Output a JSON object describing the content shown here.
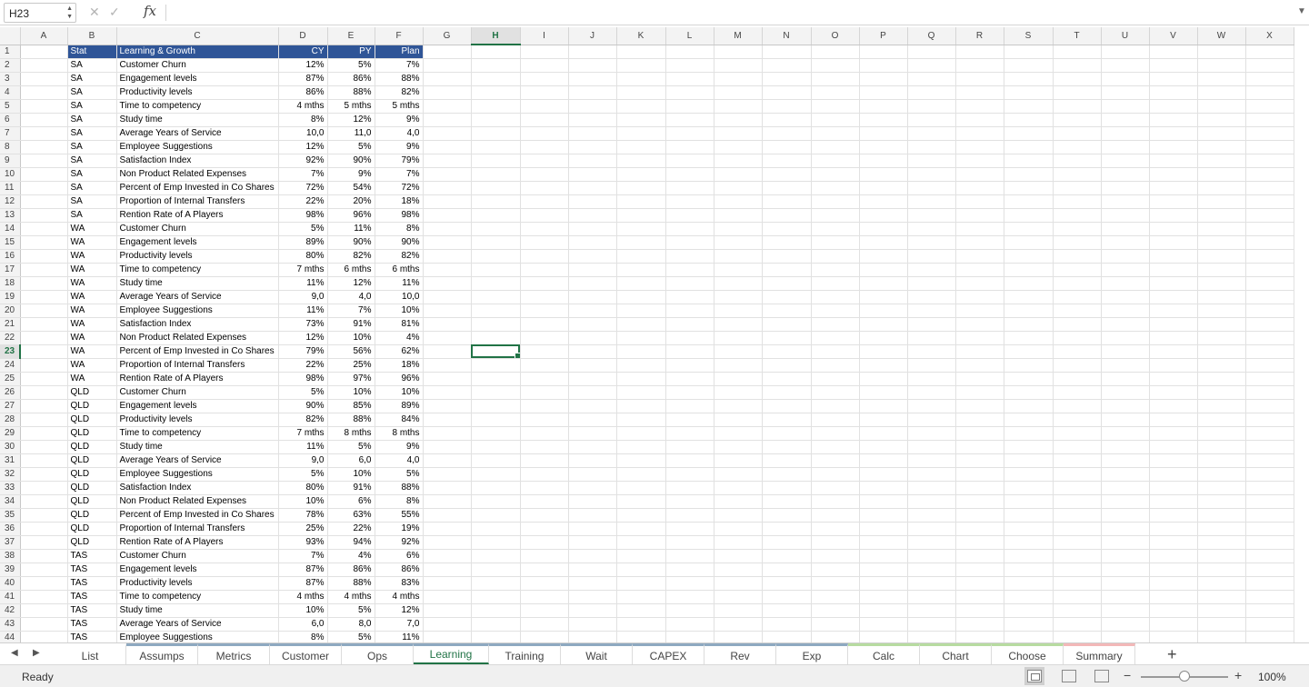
{
  "formula_bar": {
    "name_box": "H23",
    "fx_label": "fx",
    "formula": ""
  },
  "columns": [
    "A",
    "B",
    "C",
    "D",
    "E",
    "F",
    "G",
    "H",
    "I",
    "J",
    "K",
    "L",
    "M",
    "N",
    "O",
    "P",
    "Q",
    "R",
    "S",
    "T",
    "U",
    "V",
    "W",
    "X"
  ],
  "active_cell": {
    "col": "H",
    "row": 23
  },
  "table_header": [
    "Stat",
    "Learning & Growth",
    "CY",
    "PY",
    "Plan"
  ],
  "rows": [
    [
      "SA",
      "Customer Churn",
      "12%",
      "5%",
      "7%"
    ],
    [
      "SA",
      "Engagement levels",
      "87%",
      "86%",
      "88%"
    ],
    [
      "SA",
      "Productivity levels",
      "86%",
      "88%",
      "82%"
    ],
    [
      "SA",
      "Time to competency",
      "4 mths",
      "5 mths",
      "5 mths"
    ],
    [
      "SA",
      "Study time",
      "8%",
      "12%",
      "9%"
    ],
    [
      "SA",
      "Average Years of Service",
      "10,0",
      "11,0",
      "4,0"
    ],
    [
      "SA",
      "Employee Suggestions",
      "12%",
      "5%",
      "9%"
    ],
    [
      "SA",
      "Satisfaction Index",
      "92%",
      "90%",
      "79%"
    ],
    [
      "SA",
      "Non Product Related Expenses",
      "7%",
      "9%",
      "7%"
    ],
    [
      "SA",
      "Percent of Emp Invested in Co Shares",
      "72%",
      "54%",
      "72%"
    ],
    [
      "SA",
      "Proportion of Internal Transfers",
      "22%",
      "20%",
      "18%"
    ],
    [
      "SA",
      "Rention Rate of A Players",
      "98%",
      "96%",
      "98%"
    ],
    [
      "WA",
      "Customer Churn",
      "5%",
      "11%",
      "8%"
    ],
    [
      "WA",
      "Engagement levels",
      "89%",
      "90%",
      "90%"
    ],
    [
      "WA",
      "Productivity levels",
      "80%",
      "82%",
      "82%"
    ],
    [
      "WA",
      "Time to competency",
      "7 mths",
      "6 mths",
      "6 mths"
    ],
    [
      "WA",
      "Study time",
      "11%",
      "12%",
      "11%"
    ],
    [
      "WA",
      "Average Years of Service",
      "9,0",
      "4,0",
      "10,0"
    ],
    [
      "WA",
      "Employee Suggestions",
      "11%",
      "7%",
      "10%"
    ],
    [
      "WA",
      "Satisfaction Index",
      "73%",
      "91%",
      "81%"
    ],
    [
      "WA",
      "Non Product Related Expenses",
      "12%",
      "10%",
      "4%"
    ],
    [
      "WA",
      "Percent of Emp Invested in Co Shares",
      "79%",
      "56%",
      "62%"
    ],
    [
      "WA",
      "Proportion of Internal Transfers",
      "22%",
      "25%",
      "18%"
    ],
    [
      "WA",
      "Rention Rate of A Players",
      "98%",
      "97%",
      "96%"
    ],
    [
      "QLD",
      "Customer Churn",
      "5%",
      "10%",
      "10%"
    ],
    [
      "QLD",
      "Engagement levels",
      "90%",
      "85%",
      "89%"
    ],
    [
      "QLD",
      "Productivity levels",
      "82%",
      "88%",
      "84%"
    ],
    [
      "QLD",
      "Time to competency",
      "7 mths",
      "8 mths",
      "8 mths"
    ],
    [
      "QLD",
      "Study time",
      "11%",
      "5%",
      "9%"
    ],
    [
      "QLD",
      "Average Years of Service",
      "9,0",
      "6,0",
      "4,0"
    ],
    [
      "QLD",
      "Employee Suggestions",
      "5%",
      "10%",
      "5%"
    ],
    [
      "QLD",
      "Satisfaction Index",
      "80%",
      "91%",
      "88%"
    ],
    [
      "QLD",
      "Non Product Related Expenses",
      "10%",
      "6%",
      "8%"
    ],
    [
      "QLD",
      "Percent of Emp Invested in Co Shares",
      "78%",
      "63%",
      "55%"
    ],
    [
      "QLD",
      "Proportion of Internal Transfers",
      "25%",
      "22%",
      "19%"
    ],
    [
      "QLD",
      "Rention Rate of A Players",
      "93%",
      "94%",
      "92%"
    ],
    [
      "TAS",
      "Customer Churn",
      "7%",
      "4%",
      "6%"
    ],
    [
      "TAS",
      "Engagement levels",
      "87%",
      "86%",
      "86%"
    ],
    [
      "TAS",
      "Productivity levels",
      "87%",
      "88%",
      "83%"
    ],
    [
      "TAS",
      "Time to competency",
      "4 mths",
      "4 mths",
      "4 mths"
    ],
    [
      "TAS",
      "Study time",
      "10%",
      "5%",
      "12%"
    ],
    [
      "TAS",
      "Average Years of Service",
      "6,0",
      "8,0",
      "7,0"
    ],
    [
      "TAS",
      "Employee Suggestions",
      "8%",
      "5%",
      "11%"
    ]
  ],
  "sheet_tabs": [
    {
      "label": "List",
      "color": ""
    },
    {
      "label": "Assumps",
      "color": "#8ea9c1"
    },
    {
      "label": "Metrics",
      "color": "#8ea9c1"
    },
    {
      "label": "Customer",
      "color": "#8ea9c1"
    },
    {
      "label": "Ops",
      "color": "#8ea9c1"
    },
    {
      "label": "Learning",
      "color": "#8ea9c1"
    },
    {
      "label": "Training",
      "color": "#8ea9c1"
    },
    {
      "label": "Wait",
      "color": "#8ea9c1"
    },
    {
      "label": "CAPEX",
      "color": "#8ea9c1"
    },
    {
      "label": "Rev",
      "color": "#8ea9c1"
    },
    {
      "label": "Exp",
      "color": "#8ea9c1"
    },
    {
      "label": "Calc",
      "color": "#b7dba0"
    },
    {
      "label": "Chart",
      "color": "#b7dba0"
    },
    {
      "label": "Choose",
      "color": "#b7dba0"
    },
    {
      "label": "Summary",
      "color": "#f2b8b8"
    }
  ],
  "active_tab": "Learning",
  "status": {
    "text": "Ready",
    "zoom": "100%"
  }
}
